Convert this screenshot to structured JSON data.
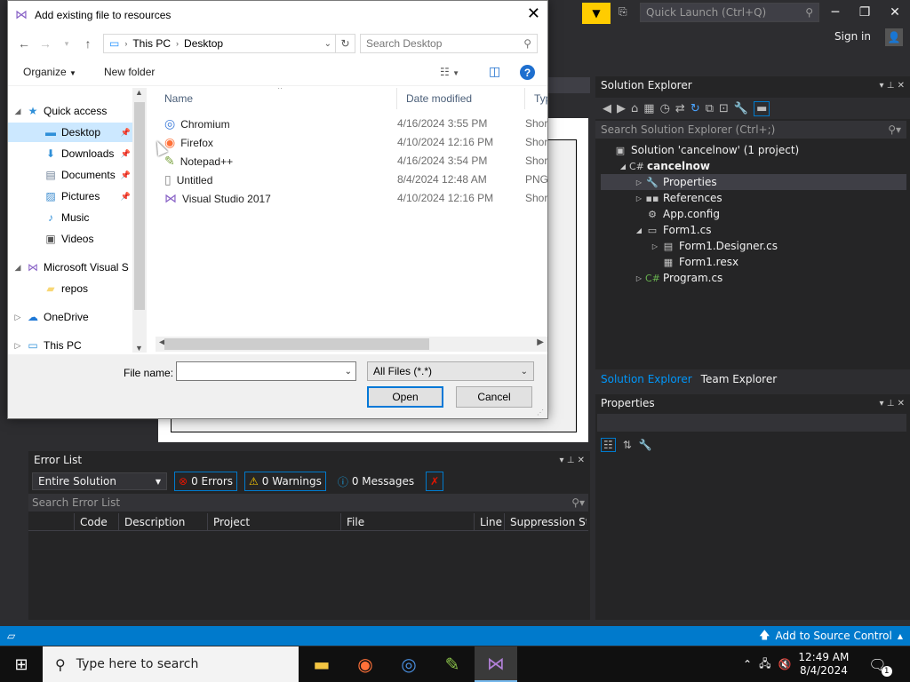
{
  "vs": {
    "quick_launch_placeholder": "Quick Launch (Ctrl+Q)",
    "sign_in": "Sign in",
    "accent": "#007acc"
  },
  "solution_explorer": {
    "title": "Solution Explorer",
    "search_placeholder": "Search Solution Explorer (Ctrl+;)",
    "tree": [
      {
        "label": "Solution 'cancelnow' (1 project)",
        "icon": "solution-icon",
        "indent": 0,
        "twisty": ""
      },
      {
        "label": "cancelnow",
        "icon": "csharp-project-icon",
        "indent": 1,
        "twisty": "◢",
        "bold": true
      },
      {
        "label": "Properties",
        "icon": "wrench-icon",
        "indent": 2,
        "twisty": "▷",
        "selected": true
      },
      {
        "label": "References",
        "icon": "references-icon",
        "indent": 2,
        "twisty": "▷"
      },
      {
        "label": "App.config",
        "icon": "config-file-icon",
        "indent": 2,
        "twisty": ""
      },
      {
        "label": "Form1.cs",
        "icon": "form-icon",
        "indent": 2,
        "twisty": "◢"
      },
      {
        "label": "Form1.Designer.cs",
        "icon": "code-file-icon",
        "indent": 3,
        "twisty": "▷"
      },
      {
        "label": "Form1.resx",
        "icon": "resx-file-icon",
        "indent": 3,
        "twisty": ""
      },
      {
        "label": "Program.cs",
        "icon": "csharp-file-icon",
        "indent": 2,
        "twisty": "▷"
      }
    ],
    "tabs": [
      "Solution Explorer",
      "Team Explorer"
    ]
  },
  "properties": {
    "title": "Properties"
  },
  "error_list": {
    "title": "Error List",
    "scope": "Entire Solution",
    "errors": "0 Errors",
    "warnings": "0 Warnings",
    "messages": "0 Messages",
    "search_placeholder": "Search Error List",
    "columns": [
      "Code",
      "Description",
      "Project",
      "File",
      "Line",
      "Suppression St..."
    ]
  },
  "statusbar": {
    "source_control": "Add to Source Control"
  },
  "taskbar": {
    "search_placeholder": "Type here to search",
    "time": "12:49 AM",
    "date": "8/4/2024",
    "notification_count": "1"
  },
  "dialog": {
    "title": "Add existing file to resources",
    "breadcrumb": [
      "This PC",
      "Desktop"
    ],
    "search_placeholder": "Search Desktop",
    "organize": "Organize",
    "new_folder": "New folder",
    "nav": [
      {
        "label": "Quick access",
        "icon": "star-icon",
        "indent": 0,
        "twisty": "◢"
      },
      {
        "label": "Desktop",
        "icon": "desktop-icon",
        "indent": 1,
        "pin": true,
        "selected": true
      },
      {
        "label": "Downloads",
        "icon": "download-icon",
        "indent": 1,
        "pin": true
      },
      {
        "label": "Documents",
        "icon": "document-icon",
        "indent": 1,
        "pin": true
      },
      {
        "label": "Pictures",
        "icon": "picture-icon",
        "indent": 1,
        "pin": true
      },
      {
        "label": "Music",
        "icon": "music-icon",
        "indent": 1
      },
      {
        "label": "Videos",
        "icon": "video-icon",
        "indent": 1
      },
      {
        "label": "Microsoft Visual S",
        "icon": "visual-studio-icon",
        "indent": 0,
        "twisty": "◢"
      },
      {
        "label": "repos",
        "icon": "folder-icon",
        "indent": 1
      },
      {
        "label": "OneDrive",
        "icon": "cloud-icon",
        "indent": 0,
        "twisty": "▷"
      },
      {
        "label": "This PC",
        "icon": "computer-icon",
        "indent": 0,
        "twisty": "▷"
      }
    ],
    "columns": {
      "name": "Name",
      "date": "Date modified",
      "type": "Type"
    },
    "files": [
      {
        "name": "Chromium",
        "date": "4/16/2024 3:55 PM",
        "type": "Short",
        "icon": "chromium-icon"
      },
      {
        "name": "Firefox",
        "date": "4/10/2024 12:16 PM",
        "type": "Short",
        "icon": "firefox-icon"
      },
      {
        "name": "Notepad++",
        "date": "4/16/2024 3:54 PM",
        "type": "Short",
        "icon": "notepadpp-icon"
      },
      {
        "name": "Untitled",
        "date": "8/4/2024 12:48 AM",
        "type": "PNG",
        "icon": "blank-file-icon"
      },
      {
        "name": "Visual Studio 2017",
        "date": "4/10/2024 12:16 PM",
        "type": "Short",
        "icon": "visual-studio-icon"
      }
    ],
    "file_name_label": "File name:",
    "file_name_value": "",
    "file_type": "All Files (*.*)",
    "open": "Open",
    "cancel": "Cancel"
  }
}
